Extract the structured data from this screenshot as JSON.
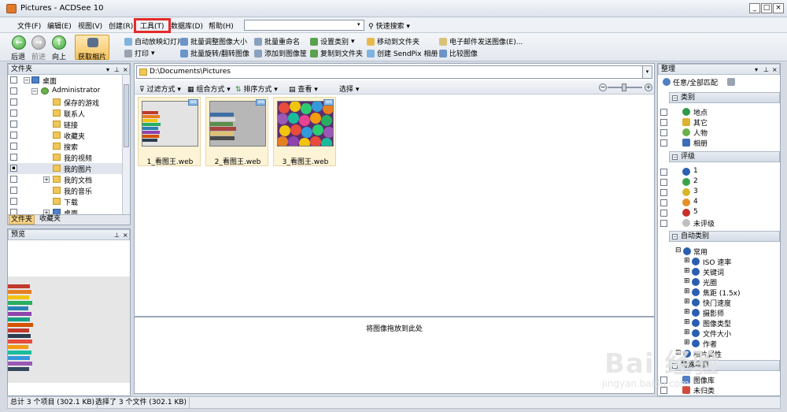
{
  "window": {
    "title": "Pictures - ACDSee 10"
  },
  "menu": [
    "文件(F)",
    "编辑(E)",
    "视图(V)",
    "创建(R)",
    "工具(T)",
    "数据库(D)",
    "帮助(H)"
  ],
  "search": {
    "value": "",
    "quick_label": "快速搜索"
  },
  "toolbar": {
    "back": "后退",
    "forward": "前进",
    "up": "向上",
    "acquire": "获取相片",
    "row1": [
      "自动放映幻灯片",
      "批量调整图像大小",
      "批量重命名",
      "设置类别",
      "移动到文件夹",
      "电子邮件发送图像(E)..."
    ],
    "row2": [
      "打印",
      "批量旋转/翻转图像",
      "添加到图像筐",
      "复制到文件夹",
      "创建 SendPix 相册",
      "比较图像"
    ]
  },
  "folders": {
    "title": "文件夹",
    "items": [
      "桌面",
      "Administrator",
      "保存的游戏",
      "联系人",
      "链接",
      "收藏夹",
      "搜索",
      "我的视频",
      "我的图片",
      "我的文档",
      "我的音乐",
      "下载",
      "桌面"
    ],
    "tabs": [
      "文件夹",
      "收藏夹"
    ]
  },
  "preview": {
    "title": "预览"
  },
  "browser": {
    "path": "D:\\Documents\\Pictures",
    "filter": "过滤方式",
    "group": "组合方式",
    "sort": "排序方式",
    "view": "查看",
    "select": "选择",
    "badge": "W8",
    "thumbnails": [
      "1_看图王.web",
      "2_看图王.web",
      "3_看图王.web"
    ],
    "drop_text": "将图像拖放到此处"
  },
  "organize": {
    "title": "整理",
    "match": "任意/全部匹配",
    "categories_title": "类别",
    "categories": [
      "地点",
      "其它",
      "人物",
      "相册"
    ],
    "ratings_title": "评级",
    "ratings": [
      "1",
      "2",
      "3",
      "4",
      "5",
      "未评级"
    ],
    "auto_title": "自动类别",
    "auto_root": "常用",
    "auto_items": [
      "ISO 速率",
      "关键词",
      "光圈",
      "焦距 (1.5x)",
      "快门速度",
      "摄影师",
      "图像类型",
      "文件大小",
      "作者",
      "相片属性"
    ],
    "special_title": "特殊项目",
    "special": [
      "图像库",
      "未归类"
    ]
  },
  "status": {
    "total": "总计 3 个项目 (302.1 KB)",
    "selected": "选择了 3 个文件 (302.1 KB)"
  },
  "watermark": {
    "text": "Bai 经验",
    "sub": "jingyan.baidu.com"
  }
}
